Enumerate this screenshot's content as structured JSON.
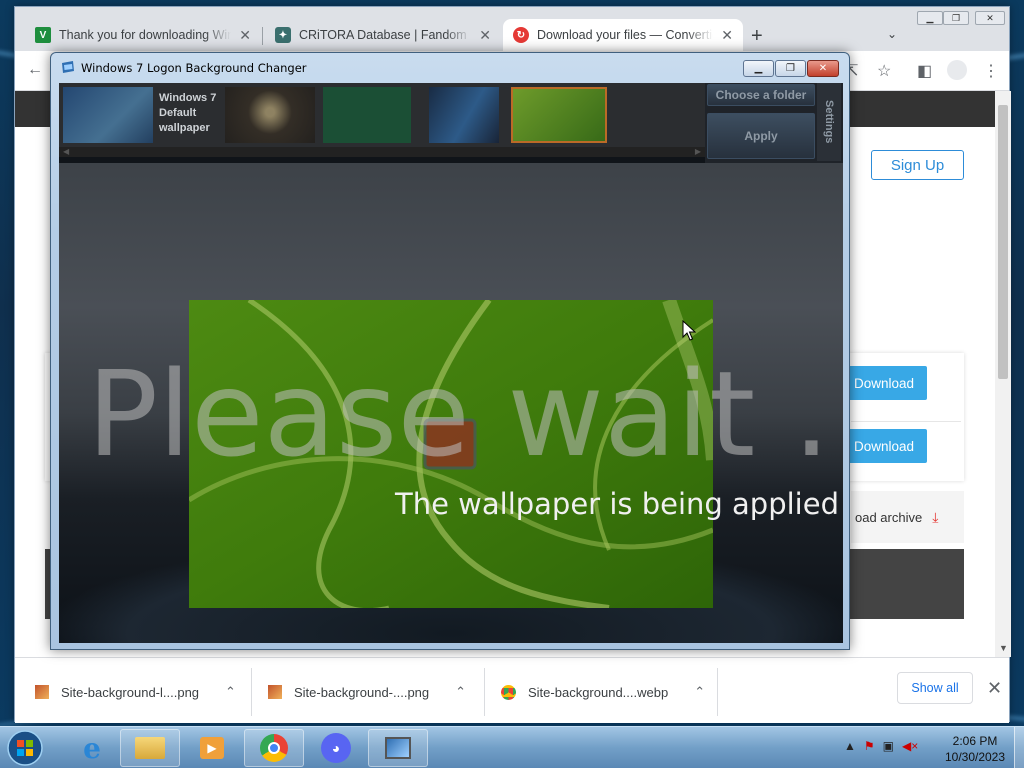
{
  "browser": {
    "tabs": [
      {
        "title": "Thank you for downloading Windows",
        "favicon": "green-v-icon"
      },
      {
        "title": "CRiTORA Database | Fandom",
        "favicon": "fandom-icon"
      },
      {
        "title": "Download your files — Convertio",
        "favicon": "convertio-icon"
      }
    ],
    "active_tab": 2,
    "site": {
      "signup_label": "Sign Up",
      "download_label_1": "Download",
      "download_label_2": "Download",
      "archive_label": "oad archive"
    },
    "downloads": [
      {
        "name": "Site-background-l....png"
      },
      {
        "name": "Site-background-....png"
      },
      {
        "name": "Site-background....webp"
      }
    ],
    "show_all_label": "Show all"
  },
  "app": {
    "title": "Windows 7 Logon Background Changer",
    "thumb_caption": "Windows 7 Default wallpaper",
    "choose_folder_label": "Choose a folder",
    "apply_label": "Apply",
    "settings_label": "Settings",
    "wait_text": "Please wait ...",
    "wait_message": "The wallpaper is being applied"
  },
  "taskbar": {
    "items": [
      "start-orb",
      "internet-explorer-icon",
      "file-explorer-icon",
      "media-player-icon",
      "chrome-icon",
      "discord-icon",
      "bg-changer-icon"
    ],
    "time": "2:06 PM",
    "date": "10/30/2023"
  }
}
